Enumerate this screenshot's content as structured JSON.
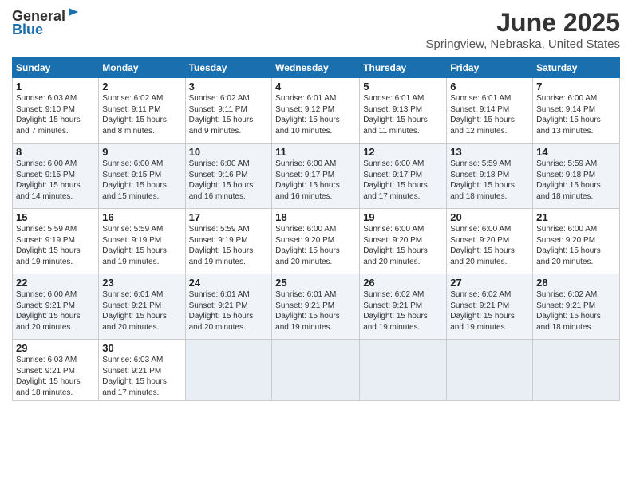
{
  "header": {
    "logo_line1": "General",
    "logo_line2": "Blue",
    "title": "June 2025",
    "subtitle": "Springview, Nebraska, United States"
  },
  "weekdays": [
    "Sunday",
    "Monday",
    "Tuesday",
    "Wednesday",
    "Thursday",
    "Friday",
    "Saturday"
  ],
  "weeks": [
    [
      {
        "day": 1,
        "info": "Sunrise: 6:03 AM\nSunset: 9:10 PM\nDaylight: 15 hours\nand 7 minutes."
      },
      {
        "day": 2,
        "info": "Sunrise: 6:02 AM\nSunset: 9:11 PM\nDaylight: 15 hours\nand 8 minutes."
      },
      {
        "day": 3,
        "info": "Sunrise: 6:02 AM\nSunset: 9:11 PM\nDaylight: 15 hours\nand 9 minutes."
      },
      {
        "day": 4,
        "info": "Sunrise: 6:01 AM\nSunset: 9:12 PM\nDaylight: 15 hours\nand 10 minutes."
      },
      {
        "day": 5,
        "info": "Sunrise: 6:01 AM\nSunset: 9:13 PM\nDaylight: 15 hours\nand 11 minutes."
      },
      {
        "day": 6,
        "info": "Sunrise: 6:01 AM\nSunset: 9:14 PM\nDaylight: 15 hours\nand 12 minutes."
      },
      {
        "day": 7,
        "info": "Sunrise: 6:00 AM\nSunset: 9:14 PM\nDaylight: 15 hours\nand 13 minutes."
      }
    ],
    [
      {
        "day": 8,
        "info": "Sunrise: 6:00 AM\nSunset: 9:15 PM\nDaylight: 15 hours\nand 14 minutes."
      },
      {
        "day": 9,
        "info": "Sunrise: 6:00 AM\nSunset: 9:15 PM\nDaylight: 15 hours\nand 15 minutes."
      },
      {
        "day": 10,
        "info": "Sunrise: 6:00 AM\nSunset: 9:16 PM\nDaylight: 15 hours\nand 16 minutes."
      },
      {
        "day": 11,
        "info": "Sunrise: 6:00 AM\nSunset: 9:17 PM\nDaylight: 15 hours\nand 16 minutes."
      },
      {
        "day": 12,
        "info": "Sunrise: 6:00 AM\nSunset: 9:17 PM\nDaylight: 15 hours\nand 17 minutes."
      },
      {
        "day": 13,
        "info": "Sunrise: 5:59 AM\nSunset: 9:18 PM\nDaylight: 15 hours\nand 18 minutes."
      },
      {
        "day": 14,
        "info": "Sunrise: 5:59 AM\nSunset: 9:18 PM\nDaylight: 15 hours\nand 18 minutes."
      }
    ],
    [
      {
        "day": 15,
        "info": "Sunrise: 5:59 AM\nSunset: 9:19 PM\nDaylight: 15 hours\nand 19 minutes."
      },
      {
        "day": 16,
        "info": "Sunrise: 5:59 AM\nSunset: 9:19 PM\nDaylight: 15 hours\nand 19 minutes."
      },
      {
        "day": 17,
        "info": "Sunrise: 5:59 AM\nSunset: 9:19 PM\nDaylight: 15 hours\nand 19 minutes."
      },
      {
        "day": 18,
        "info": "Sunrise: 6:00 AM\nSunset: 9:20 PM\nDaylight: 15 hours\nand 20 minutes."
      },
      {
        "day": 19,
        "info": "Sunrise: 6:00 AM\nSunset: 9:20 PM\nDaylight: 15 hours\nand 20 minutes."
      },
      {
        "day": 20,
        "info": "Sunrise: 6:00 AM\nSunset: 9:20 PM\nDaylight: 15 hours\nand 20 minutes."
      },
      {
        "day": 21,
        "info": "Sunrise: 6:00 AM\nSunset: 9:20 PM\nDaylight: 15 hours\nand 20 minutes."
      }
    ],
    [
      {
        "day": 22,
        "info": "Sunrise: 6:00 AM\nSunset: 9:21 PM\nDaylight: 15 hours\nand 20 minutes."
      },
      {
        "day": 23,
        "info": "Sunrise: 6:01 AM\nSunset: 9:21 PM\nDaylight: 15 hours\nand 20 minutes."
      },
      {
        "day": 24,
        "info": "Sunrise: 6:01 AM\nSunset: 9:21 PM\nDaylight: 15 hours\nand 20 minutes."
      },
      {
        "day": 25,
        "info": "Sunrise: 6:01 AM\nSunset: 9:21 PM\nDaylight: 15 hours\nand 19 minutes."
      },
      {
        "day": 26,
        "info": "Sunrise: 6:02 AM\nSunset: 9:21 PM\nDaylight: 15 hours\nand 19 minutes."
      },
      {
        "day": 27,
        "info": "Sunrise: 6:02 AM\nSunset: 9:21 PM\nDaylight: 15 hours\nand 19 minutes."
      },
      {
        "day": 28,
        "info": "Sunrise: 6:02 AM\nSunset: 9:21 PM\nDaylight: 15 hours\nand 18 minutes."
      }
    ],
    [
      {
        "day": 29,
        "info": "Sunrise: 6:03 AM\nSunset: 9:21 PM\nDaylight: 15 hours\nand 18 minutes."
      },
      {
        "day": 30,
        "info": "Sunrise: 6:03 AM\nSunset: 9:21 PM\nDaylight: 15 hours\nand 17 minutes."
      },
      null,
      null,
      null,
      null,
      null
    ]
  ]
}
